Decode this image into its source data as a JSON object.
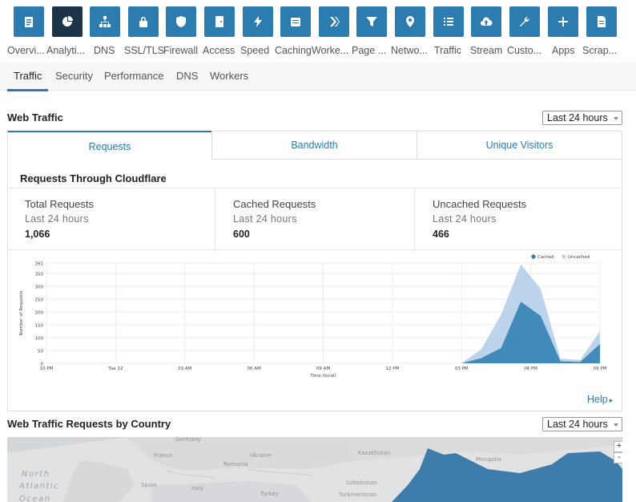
{
  "apps": [
    {
      "label": "Overvi...",
      "icon": "clipboard-icon",
      "active": false
    },
    {
      "label": "Analyti...",
      "icon": "pie-chart-icon",
      "active": true
    },
    {
      "label": "DNS",
      "icon": "sitemap-icon",
      "active": false
    },
    {
      "label": "SSL/TLS",
      "icon": "lock-icon",
      "active": false
    },
    {
      "label": "Firewall",
      "icon": "shield-icon",
      "active": false
    },
    {
      "label": "Access",
      "icon": "door-icon",
      "active": false
    },
    {
      "label": "Speed",
      "icon": "bolt-icon",
      "active": false
    },
    {
      "label": "Caching",
      "icon": "server-icon",
      "active": false
    },
    {
      "label": "Worke...",
      "icon": "workers-icon",
      "active": false
    },
    {
      "label": "Page ...",
      "icon": "filter-icon",
      "active": false
    },
    {
      "label": "Netwo...",
      "icon": "location-pin-icon",
      "active": false
    },
    {
      "label": "Traffic",
      "icon": "list-icon",
      "active": false
    },
    {
      "label": "Stream",
      "icon": "cloud-upload-icon",
      "active": false
    },
    {
      "label": "Custo...",
      "icon": "wrench-icon",
      "active": false
    },
    {
      "label": "Apps",
      "icon": "plus-icon",
      "active": false
    },
    {
      "label": "Scrap...",
      "icon": "document-icon",
      "active": false
    }
  ],
  "subtabs": [
    "Traffic",
    "Security",
    "Performance",
    "DNS",
    "Workers"
  ],
  "web_traffic": {
    "title": "Web Traffic",
    "range": "Last 24 hours",
    "tabs": [
      "Requests",
      "Bandwidth",
      "Unique Visitors"
    ],
    "card_title": "Requests Through Cloudflare",
    "stats": [
      {
        "name": "Total Requests",
        "period": "Last 24 hours",
        "value": "1,066"
      },
      {
        "name": "Cached Requests",
        "period": "Last 24 hours",
        "value": "600"
      },
      {
        "name": "Uncached Requests",
        "period": "Last 24 hours",
        "value": "466"
      }
    ],
    "help": "Help"
  },
  "chart_data": {
    "type": "area",
    "ylabel": "Number of Requests",
    "xlabel": "Time (local)",
    "ylim": [
      0,
      391
    ],
    "yticks": [
      "391",
      "350",
      "300",
      "250",
      "200",
      "150",
      "100",
      "50",
      "0"
    ],
    "xticks": [
      "10 PM",
      "Tue 12",
      "03 AM",
      "06 AM",
      "09 AM",
      "12 PM",
      "03 PM",
      "06 PM",
      "09 PM"
    ],
    "legend_position": "top-right",
    "series": [
      {
        "name": "Cached",
        "color": "#2c7cb0",
        "values": [
          0,
          0,
          0,
          0,
          0,
          0,
          0,
          0,
          0,
          0,
          0,
          0,
          0,
          0,
          0,
          0,
          0,
          0,
          0,
          0,
          0,
          0,
          20,
          60,
          240,
          185,
          8,
          5,
          75
        ]
      },
      {
        "name": "Uncached",
        "color": "#bcd3ec",
        "values": [
          0,
          0,
          0,
          0,
          0,
          0,
          0,
          0,
          0,
          0,
          0,
          0,
          0,
          0,
          0,
          0,
          0,
          0,
          0,
          0,
          0,
          0,
          35,
          130,
          145,
          105,
          10,
          8,
          50
        ]
      }
    ]
  },
  "country": {
    "title": "Web Traffic Requests by Country",
    "range": "Last 24 hours",
    "map_labels": [
      "Germany",
      "France",
      "Ukraine",
      "Kazakhstan",
      "Mongolia",
      "Romania",
      "Uzbekistan",
      "Turkmenistan",
      "Spain",
      "Turkey",
      "Italy",
      "North",
      "Atlantic",
      "Ocean"
    ],
    "zoom_in": "+",
    "zoom_out": "-"
  }
}
